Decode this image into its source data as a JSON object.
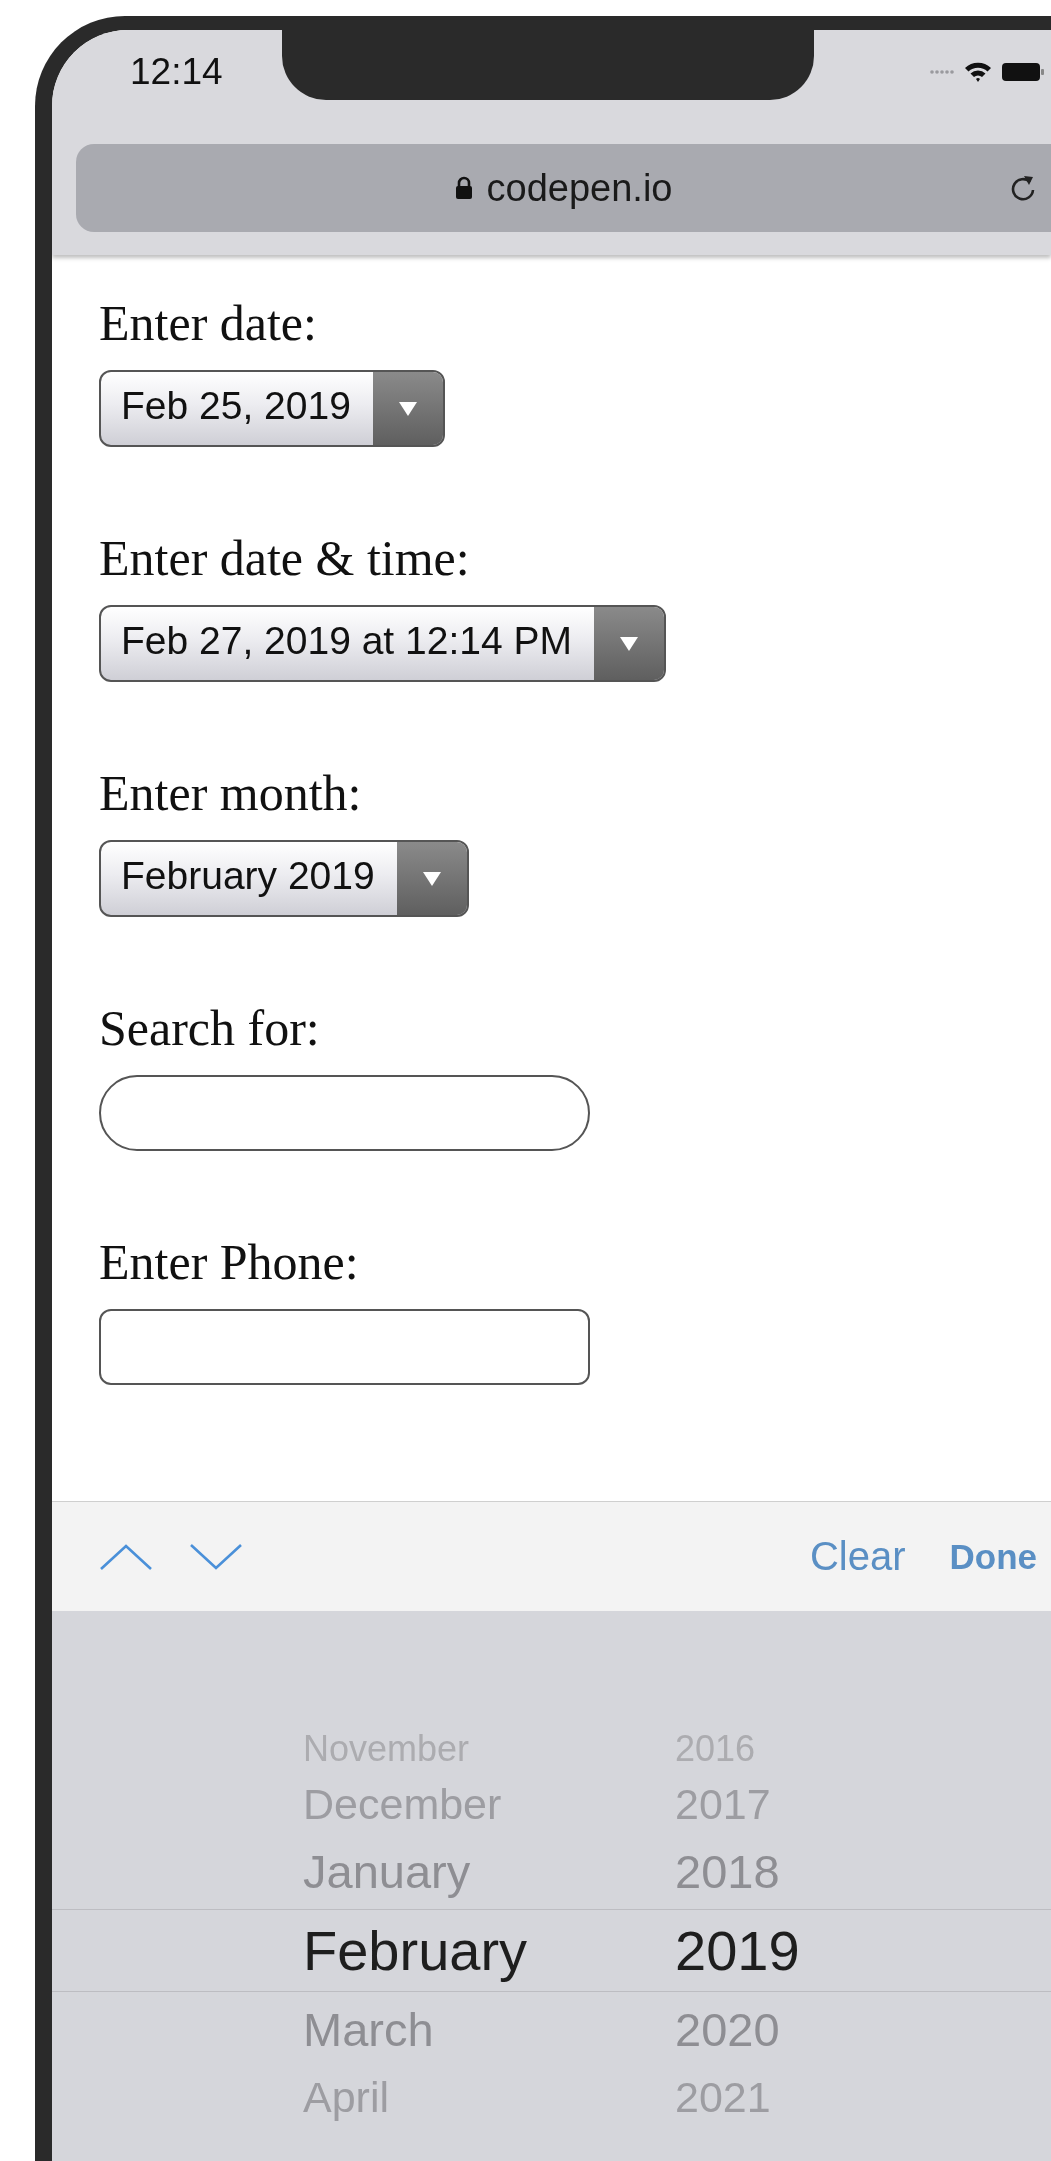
{
  "status_bar": {
    "time": "12:14"
  },
  "browser": {
    "url": "codepen.io"
  },
  "form": {
    "fields": [
      {
        "label": "Enter date:",
        "kind": "select",
        "value": "Feb 25, 2019"
      },
      {
        "label": "Enter date & time:",
        "kind": "select",
        "value": "Feb 27, 2019 at 12:14 PM"
      },
      {
        "label": "Enter month:",
        "kind": "select",
        "value": "February 2019"
      },
      {
        "label": "Search for:",
        "kind": "search"
      },
      {
        "label": "Enter Phone:",
        "kind": "text"
      }
    ]
  },
  "toolbar": {
    "clear": "Clear",
    "done": "Done"
  },
  "picker": {
    "months": [
      {
        "label": "November",
        "selected": false
      },
      {
        "label": "December",
        "selected": false
      },
      {
        "label": "January",
        "selected": false
      },
      {
        "label": "February",
        "selected": true
      },
      {
        "label": "March",
        "selected": false
      },
      {
        "label": "April",
        "selected": false
      }
    ],
    "years": [
      {
        "label": "2016",
        "selected": false
      },
      {
        "label": "2017",
        "selected": false
      },
      {
        "label": "2018",
        "selected": false
      },
      {
        "label": "2019",
        "selected": true
      },
      {
        "label": "2020",
        "selected": false
      },
      {
        "label": "2021",
        "selected": false
      }
    ]
  }
}
